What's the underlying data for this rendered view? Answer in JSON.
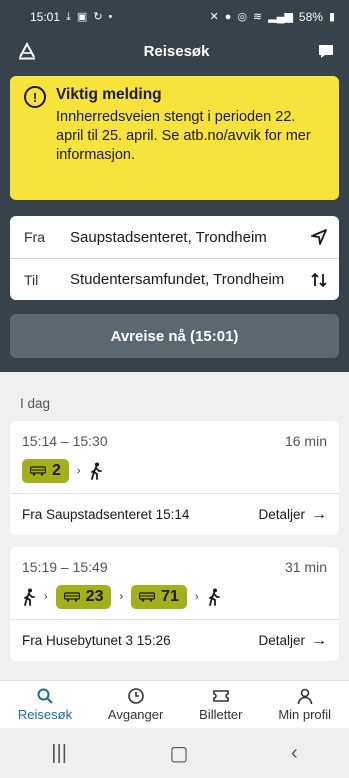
{
  "status_bar": {
    "time": "15:01",
    "battery": "58%"
  },
  "header": {
    "title": "Reisesøk"
  },
  "alert": {
    "title": "Viktig melding",
    "body": "Innherredsveien stengt i perioden 22. april til 25. april. Se atb.no/avvik for mer informasjon."
  },
  "search": {
    "from_label": "Fra",
    "from_value": "Saupstadsenteret, Trondheim",
    "to_label": "Til",
    "to_value": "Studentersamfundet, Trondheim"
  },
  "depart_button": "Avreise nå (15:01)",
  "day_label": "I dag",
  "trips": [
    {
      "time_range": "15:14 – 15:30",
      "duration": "16 min",
      "legs": [
        "2"
      ],
      "from": "Fra Saupstadsenteret 15:14",
      "details": "Detaljer"
    },
    {
      "time_range": "15:19 – 15:49",
      "duration": "31 min",
      "legs": [
        "23",
        "71"
      ],
      "from": "Fra Husebytunet 3 15:26",
      "details": "Detaljer"
    }
  ],
  "bottom_nav": [
    {
      "label": "Reisesøk",
      "icon": "search-icon"
    },
    {
      "label": "Avganger",
      "icon": "clock-icon"
    },
    {
      "label": "Billetter",
      "icon": "ticket-icon"
    },
    {
      "label": "Min profil",
      "icon": "profile-icon"
    }
  ],
  "colors": {
    "header": "#37424a",
    "alert": "#f7e33c",
    "bus": "#a3b01a",
    "active_nav": "#1a6aa8"
  }
}
